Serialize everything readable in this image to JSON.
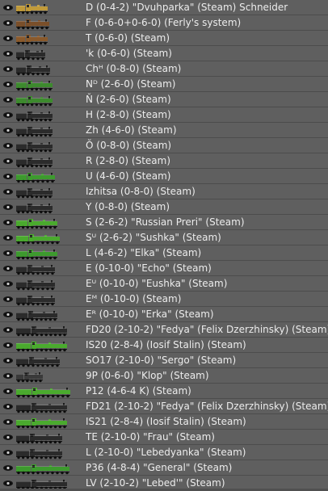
{
  "engines": [
    {
      "label": "D (0-4-2) \"Dvuhparka\" (Steam) Schneider",
      "color": "#c09a3a",
      "size": 0.45
    },
    {
      "label": "F (0-6-0+0-6-0) (Ferly's system)",
      "color": "#7a4f2a",
      "size": 0.48
    },
    {
      "label": "T (0-6-0) (Steam)",
      "color": "#8a5a2c",
      "size": 0.45
    },
    {
      "label": "'k (0-6-0) (Steam)",
      "color": "#2b2b2b",
      "size": 0.4
    },
    {
      "label": "Chᴴ (0-8-0) (Steam)",
      "color": "#2b2b2b",
      "size": 0.5
    },
    {
      "label": "Nᴰ (2-6-0) (Steam)",
      "color": "#3d8a2e",
      "size": 0.55
    },
    {
      "label": "Ň (2-6-0) (Steam)",
      "color": "#3d8a2e",
      "size": 0.55
    },
    {
      "label": "H (2-8-0) (Steam)",
      "color": "#2b2b2b",
      "size": 0.55
    },
    {
      "label": "Zh (4-6-0) (Steam)",
      "color": "#2b2b2b",
      "size": 0.55
    },
    {
      "label": "Ŏ (0-8-0) (Steam)",
      "color": "#2b2b2b",
      "size": 0.55
    },
    {
      "label": "R (2-8-0) (Steam)",
      "color": "#2b2b2b",
      "size": 0.55
    },
    {
      "label": "U (4-6-0) (Steam)",
      "color": "#3d9a2e",
      "size": 0.6
    },
    {
      "label": "Izhitsa (0-8-0) (Steam)",
      "color": "#2b2b2b",
      "size": 0.55
    },
    {
      "label": "Y (0-8-0) (Steam)",
      "color": "#2b2b2b",
      "size": 0.55
    },
    {
      "label": "S (2-6-2) \"Russian Preri\" (Steam)",
      "color": "#4aaa2e",
      "size": 0.65
    },
    {
      "label": "Sᵁ (2-6-2) \"Sushka\" (Steam)",
      "color": "#4aaa2e",
      "size": 0.7
    },
    {
      "label": "L (4-6-2) \"Elka\" (Steam)",
      "color": "#3d9a2e",
      "size": 0.65
    },
    {
      "label": "E (0-10-0) \"Echo\" (Steam)",
      "color": "#2b2b2b",
      "size": 0.6
    },
    {
      "label": "Eᵁ (0-10-0) \"Eushka\" (Steam)",
      "color": "#2b2b2b",
      "size": 0.6
    },
    {
      "label": "Eᴹ (0-10-0) (Steam)",
      "color": "#2b2b2b",
      "size": 0.6
    },
    {
      "label": "Eᴿ (0-10-0) \"Erka\" (Steam)",
      "color": "#2b2b2b",
      "size": 0.65
    },
    {
      "label": "FD20 (2-10-2) \"Fedya\" (Felix Dzerzhinsky) (Steam)",
      "color": "#2b2b2b",
      "size": 0.85
    },
    {
      "label": "IS20 (2-8-4) (Iosif Stalin) (Steam)",
      "color": "#4aaa2e",
      "size": 0.85
    },
    {
      "label": "SO17 (2-10-0) \"Sergo\" (Steam)",
      "color": "#2b2b2b",
      "size": 0.7
    },
    {
      "label": "9P (0-6-0) \"Klop\" (Steam)",
      "color": "#3a3a3a",
      "size": 0.35
    },
    {
      "label": "P12 (4-6-4 K) (Steam)",
      "color": "#4aaa2e",
      "size": 0.92
    },
    {
      "label": "FD21 (2-10-2) \"Fedya\" (Felix Dzerzhinsky) (Steam)",
      "color": "#2b2b2b",
      "size": 0.85
    },
    {
      "label": "IS21 (2-8-4) (Iosif Stalin) (Steam)",
      "color": "#4aaa2e",
      "size": 0.85
    },
    {
      "label": "TE (2-10-0) \"Frau\" (Steam)",
      "color": "#2b2b2b",
      "size": 0.75
    },
    {
      "label": "L (2-10-0) \"Lebedyanka\" (Steam)",
      "color": "#2b2b2b",
      "size": 0.75
    },
    {
      "label": "P36 (4-8-4) \"General\" (Steam)",
      "color": "#3d9a2e",
      "size": 0.9
    },
    {
      "label": "LV (2-10-2) \"Lebed'\" (Steam)",
      "color": "#2b2b2b",
      "size": 0.85
    }
  ]
}
